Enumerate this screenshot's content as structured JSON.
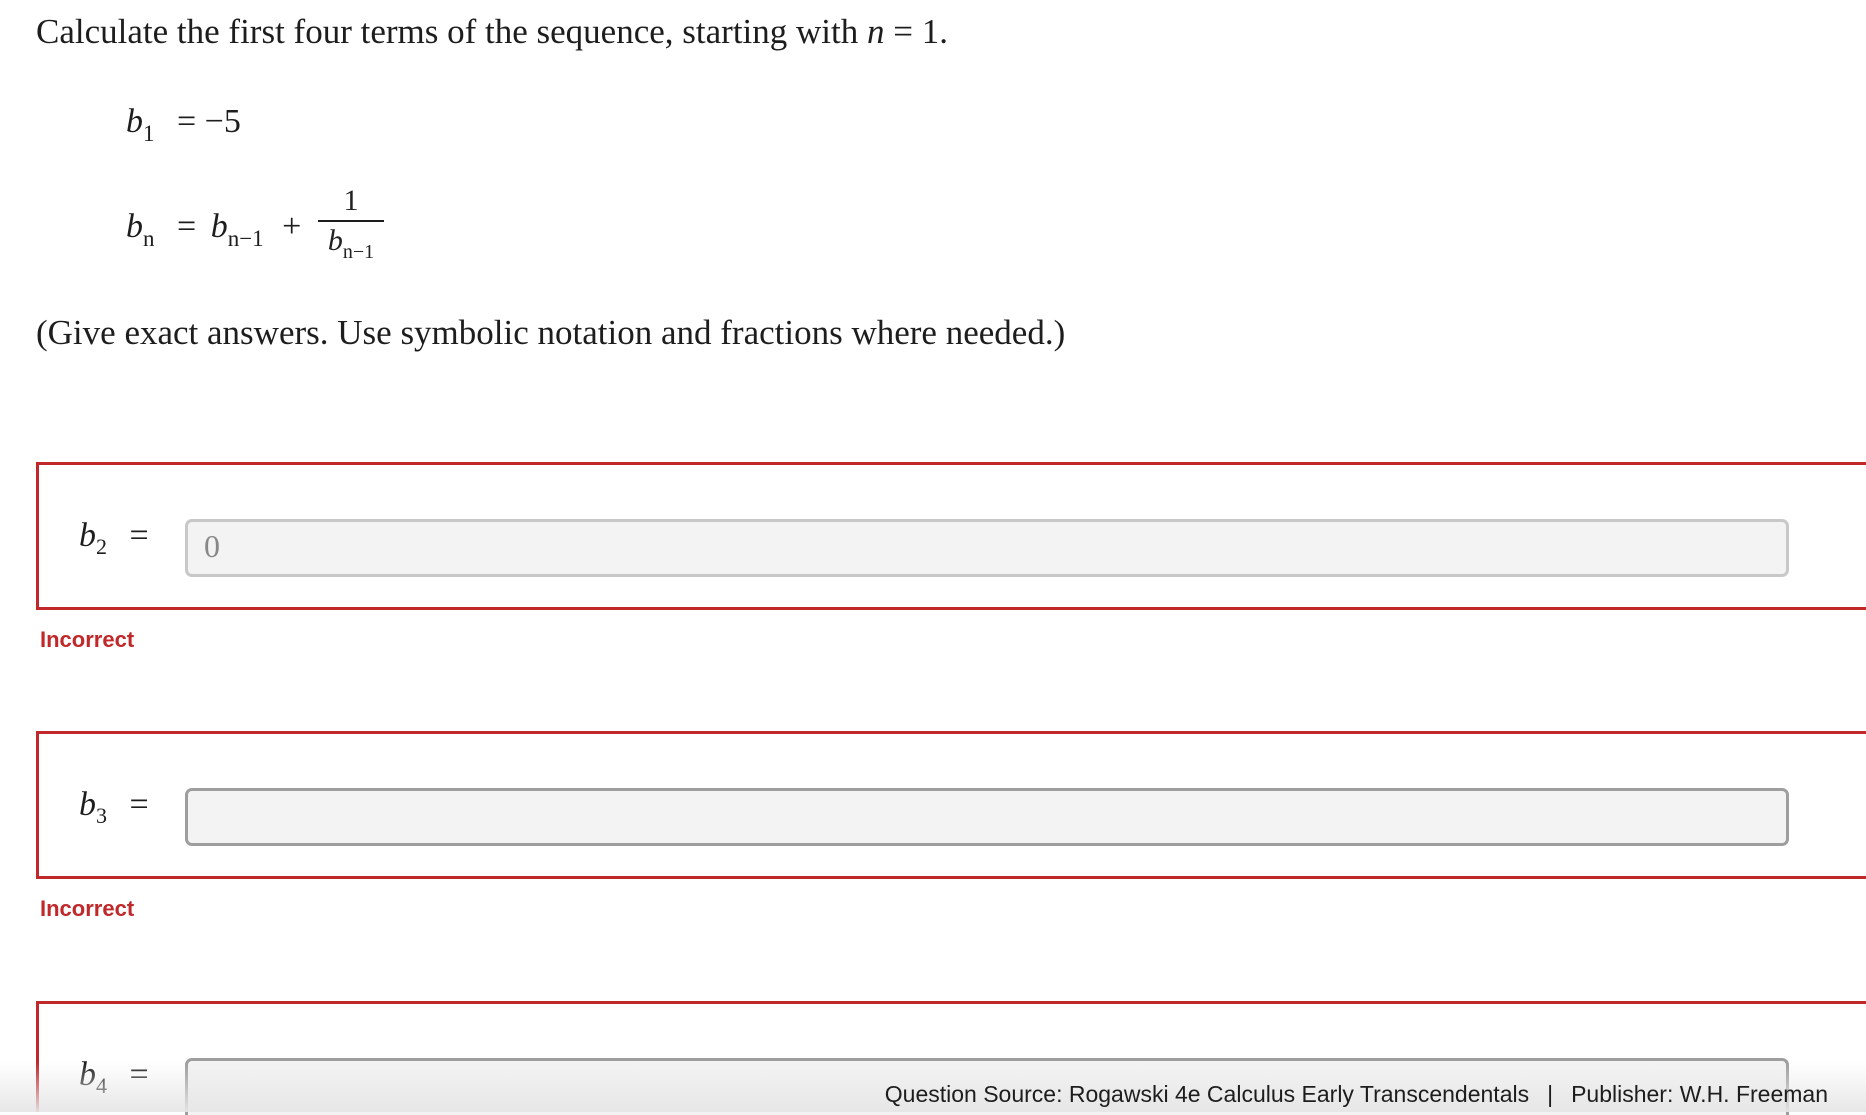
{
  "question": {
    "prompt_text": "Calculate the first four terms of the sequence, starting with",
    "prompt_var": "n",
    "prompt_eq": "= 1.",
    "b1_lhs_var": "b",
    "b1_lhs_sub": "1",
    "b1_rhs": "= −5",
    "bn_lhs_var": "b",
    "bn_lhs_sub": "n",
    "bn_eq": "=",
    "bn_term_var": "b",
    "bn_term_sub": "n−1",
    "bn_plus": "+",
    "frac_num": "1",
    "frac_den_var": "b",
    "frac_den_sub": "n−1",
    "instructions": "(Give exact answers. Use symbolic notation and fractions where needed.)"
  },
  "answers": [
    {
      "var": "b",
      "sub": "2",
      "eq": "=",
      "value": "0",
      "feedback": "Incorrect"
    },
    {
      "var": "b",
      "sub": "3",
      "eq": "=",
      "value": "",
      "feedback": "Incorrect"
    },
    {
      "var": "b",
      "sub": "4",
      "eq": "=",
      "value": "",
      "feedback": ""
    }
  ],
  "footer": {
    "source": "Question Source: Rogawski 4e Calculus Early Transcendentals",
    "separator": "|",
    "publisher": "Publisher: W.H. Freeman"
  },
  "colors": {
    "error": "#c0282a",
    "input_bg": "#f3f3f3"
  }
}
